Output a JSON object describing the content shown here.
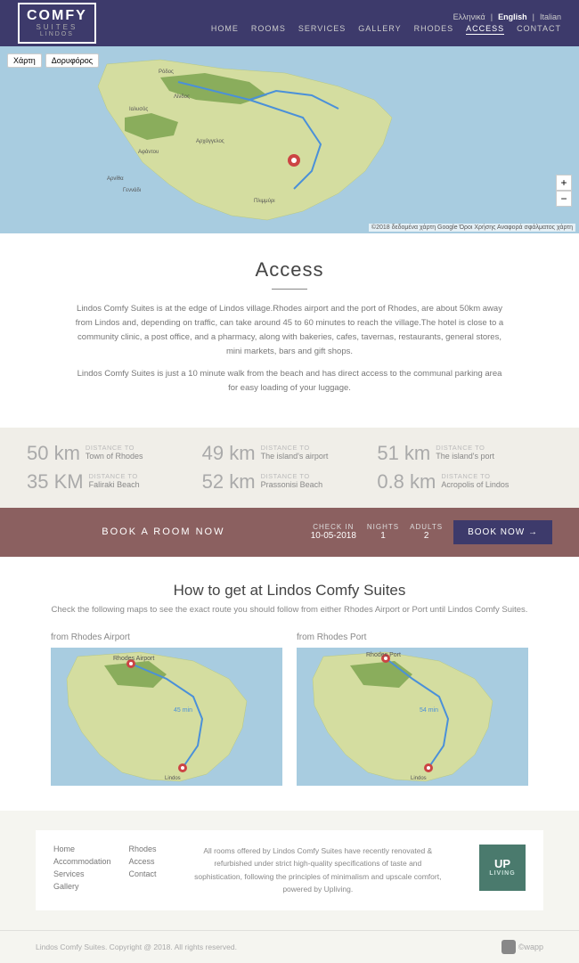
{
  "header": {
    "logo": {
      "comfy": "COMFY",
      "suites": "SUITES",
      "lindos": "LINDOS"
    },
    "languages": [
      "Ελληνικά",
      "English",
      "Italian"
    ],
    "active_lang": "English",
    "nav": [
      {
        "label": "HOME",
        "active": false
      },
      {
        "label": "ROOMS",
        "active": false
      },
      {
        "label": "SERVICES",
        "active": false
      },
      {
        "label": "GALLERY",
        "active": false
      },
      {
        "label": "RHODES",
        "active": false
      },
      {
        "label": "ACCESS",
        "active": true
      },
      {
        "label": "CONTACT",
        "active": false
      }
    ]
  },
  "map_controls": {
    "btn1": "Χάρτη",
    "btn2": "Δορυφόρος",
    "credit": "©2018 δεδομένα χάρτη Google  Όροι Χρήσης  Αναφορά σφάλματος χάρτη"
  },
  "access": {
    "title": "Access",
    "desc1": "Lindos Comfy Suites is at the edge of Lindos village.Rhodes airport and the port of Rhodes, are about 50km away from Lindos and, depending on traffic, can take around 45 to 60 minutes to reach the village.The hotel is close to a community clinic, a post office, and a pharmacy, along with bakeries, cafes, tavernas, restaurants, general stores, mini markets, bars and gift shops.",
    "desc2": "Lindos Comfy Suites is just a 10 minute walk from the beach and has direct access to the communal parking area for easy loading of your luggage."
  },
  "distances": [
    {
      "km": "50 km",
      "label": "Distance to",
      "name": "Town of Rhodes"
    },
    {
      "km": "49 km",
      "label": "Distance to",
      "name": "The island's airport"
    },
    {
      "km": "51 km",
      "label": "Distance to",
      "name": "The island's port"
    },
    {
      "km": "35 KM",
      "label": "Distance to",
      "name": "Faliraki Beach"
    },
    {
      "km": "52 km",
      "label": "Distance to",
      "name": "Prassonisi Beach"
    },
    {
      "km": "0.8 km",
      "label": "Distance to",
      "name": "Acropolis of Lindos"
    }
  ],
  "booking": {
    "label": "BOOK A ROOM NOW",
    "checkin_label": "Check In",
    "checkin_val": "10-05-2018",
    "nights_label": "Nights",
    "nights_val": "1",
    "adults_label": "Adults",
    "adults_val": "2",
    "btn": "BOOK NOW →"
  },
  "how_to_get": {
    "title": "How to get at Lindos Comfy Suites",
    "desc": "Check the following maps to see the exact route you should follow from either Rhodes Airport or Port until Lindos Comfy Suites.",
    "map1_title": "from Rhodes Airport",
    "map2_title": "from Rhodes Port"
  },
  "footer": {
    "col1": [
      "Home",
      "Accommodation",
      "Services",
      "Gallery"
    ],
    "col2": [
      "Rhodes",
      "Access",
      "Contact"
    ],
    "text": "All rooms offered by Lindos Comfy Suites have recently renovated & refurbished under strict high-quality specifications of taste and sophistication, following the principles of minimalism and upscale comfort, powered by Upliving.",
    "upliving": {
      "line1": "UP",
      "line2": "LIVING"
    }
  },
  "bottom": {
    "copyright": "Lindos Comfy Suites. Copyright @ 2018. All rights reserved.",
    "wapp": "©wapp"
  }
}
